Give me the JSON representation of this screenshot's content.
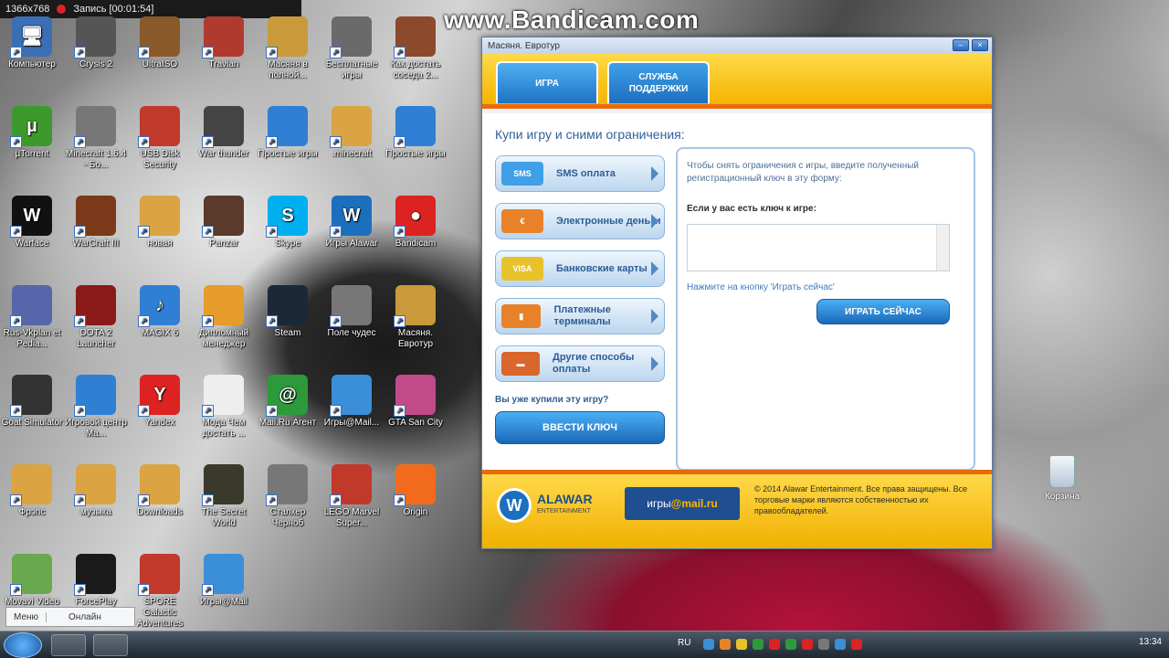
{
  "recording": {
    "resolution": "1366x768",
    "record_label": "Запись [00:01:54]"
  },
  "watermark": "www.Bandicam.com",
  "desktop_icons": [
    {
      "label": "Компьютер",
      "color": "#3b6fb5",
      "glyph": "🖥"
    },
    {
      "label": "Crysis 2",
      "color": "#555"
    },
    {
      "label": "UltraISO",
      "color": "#8a5a2a"
    },
    {
      "label": "Travian",
      "color": "#b03a2e"
    },
    {
      "label": "Масяня в полной...",
      "color": "#c99a3a"
    },
    {
      "label": "Бесплатные игры",
      "color": "#6a6a6a"
    },
    {
      "label": "Как достать соседа 2...",
      "color": "#8b4a2b"
    },
    {
      "label": "µTorrent",
      "color": "#3c9a2c",
      "glyph": "µ"
    },
    {
      "label": "Minecraft 1.6.4 - Бо...",
      "color": "#777"
    },
    {
      "label": "USB Disk Security",
      "color": "#c0392b"
    },
    {
      "label": "War thunder",
      "color": "#444"
    },
    {
      "label": "Простые игры",
      "color": "#2f7fd4"
    },
    {
      "label": ".minecraft",
      "color": "#d9a441"
    },
    {
      "label": "Простые игры",
      "color": "#2f7fd4"
    },
    {
      "label": "Warface",
      "color": "#111",
      "glyph": "W"
    },
    {
      "label": "WarCraft III",
      "color": "#7a3a1a"
    },
    {
      "label": "новая",
      "color": "#d9a441"
    },
    {
      "label": "Panzar",
      "color": "#5a3a2a"
    },
    {
      "label": "Skype",
      "color": "#00aff0",
      "glyph": "S"
    },
    {
      "label": "Игры Alawar",
      "color": "#1c6fbd",
      "glyph": "W"
    },
    {
      "label": "Bandicam",
      "color": "#d22",
      "glyph": "●"
    },
    {
      "label": "Rus-Vkplan et Pedia...",
      "color": "#5566aa"
    },
    {
      "label": "DOTA 2 Launcher",
      "color": "#8a1a1a"
    },
    {
      "label": "MAGIX 6",
      "color": "#2f7fd4",
      "glyph": "♪"
    },
    {
      "label": "Дипломный менеджер",
      "color": "#e69b2a"
    },
    {
      "label": "Steam",
      "color": "#1b2838"
    },
    {
      "label": "Поле чудес",
      "color": "#777"
    },
    {
      "label": "Масяня. Евротур",
      "color": "#c99a3a"
    },
    {
      "label": "Goat Simulator",
      "color": "#333"
    },
    {
      "label": "Игровой центр Ma...",
      "color": "#2f7fd4"
    },
    {
      "label": "Yandex",
      "color": "#d22",
      "glyph": "Y"
    },
    {
      "label": "Мода Чем достать ...",
      "color": "#eeeeee"
    },
    {
      "label": "Mail.Ru Агент",
      "color": "#2c9a3a",
      "glyph": "@"
    },
    {
      "label": "Игры@Mail...",
      "color": "#3b8fd8"
    },
    {
      "label": "GTA San City",
      "color": "#c24a8a"
    },
    {
      "label": "Фрэпс",
      "color": "#d9a441"
    },
    {
      "label": "музыка",
      "color": "#d9a441"
    },
    {
      "label": "Downloads",
      "color": "#d9a441"
    },
    {
      "label": "The Secret World",
      "color": "#3a3a2a"
    },
    {
      "label": "Сталкер Черноб",
      "color": "#777"
    },
    {
      "label": "LEGO Marvel Super...",
      "color": "#c0392b"
    },
    {
      "label": "Origin",
      "color": "#f26b1d"
    },
    {
      "label": "Movavi Video Suite",
      "color": "#6aa84f"
    },
    {
      "label": "ForcePlay",
      "color": "#1a1a1a"
    },
    {
      "label": "SPORE Galactic Adventures",
      "color": "#c0392b"
    },
    {
      "label": "Игры@Mail",
      "color": "#3b8fd8"
    }
  ],
  "recycle_bin": "Корзина",
  "chat_bar": {
    "menu": "Меню",
    "online": "Онлайн"
  },
  "window": {
    "title": "Масяня. Евротур",
    "tabs": [
      "ИГРА",
      "СЛУЖБА ПОДДЕРЖКИ"
    ],
    "headline": "Купи игру и сними ограничения:",
    "payment_methods": [
      {
        "label": "SMS оплата",
        "color": "#3fa0e8",
        "badge": "SMS"
      },
      {
        "label": "Электронные деньги",
        "color": "#e8822a",
        "badge": "€"
      },
      {
        "label": "Банковские карты",
        "color": "#e8c22a",
        "badge": "VISA"
      },
      {
        "label": "Платежные терминалы",
        "color": "#e8822a",
        "badge": "▮"
      },
      {
        "label": "Другие способы оплаты",
        "color": "#d9662a",
        "badge": "▬"
      }
    ],
    "already_bought": "Вы уже купили эту игру?",
    "enter_key_btn": "ВВЕСТИ КЛЮЧ",
    "panel": {
      "hint": "Чтобы снять ограничения с игры, введите полученный регистрационный ключ в эту форму:",
      "key_label": "Если у вас есть ключ к игре:",
      "key_value": "",
      "press_hint": "Нажмите на кнопку 'Играть сейчас'",
      "play_btn": "ИГРАТЬ СЕЙЧАС"
    },
    "footer": {
      "alawar": "ALAWAR",
      "alawar_sub": "ENTERTAINMENT",
      "mailru_pre": "игры",
      "mailru_brand": "@mail.ru",
      "copyright": "© 2014 Alawar Entertainment. Все права защищены. Все торговые марки являются собственностью их правообладателей."
    }
  },
  "taskbar": {
    "lang": "RU",
    "time": "13:34"
  }
}
